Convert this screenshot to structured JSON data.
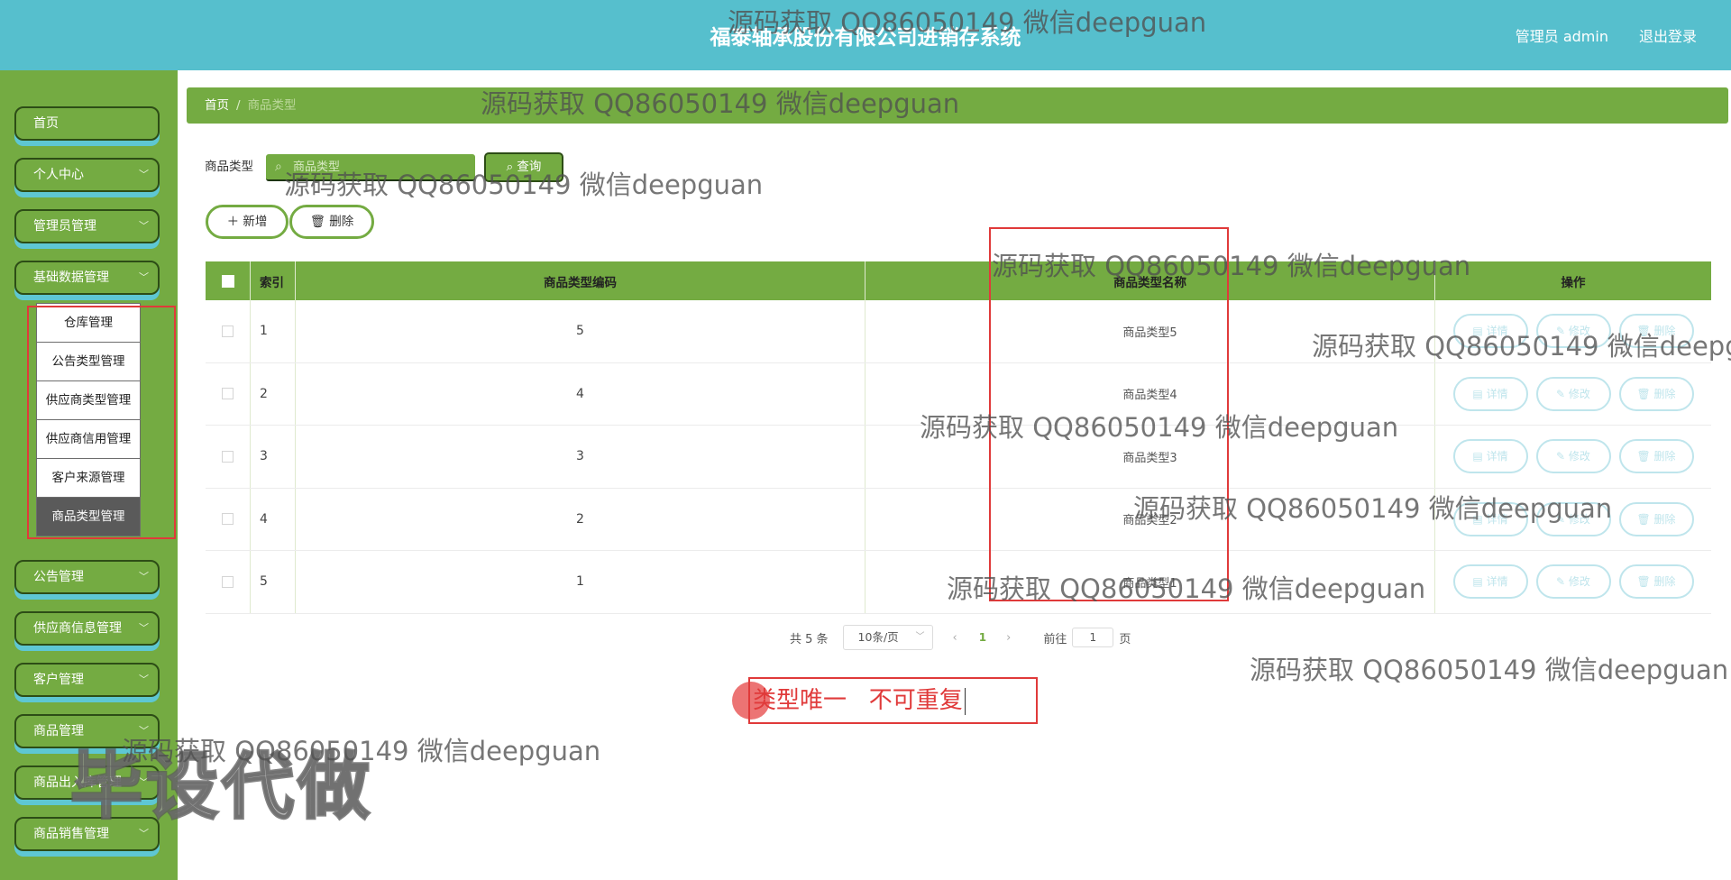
{
  "header": {
    "title": "福泰轴承股份有限公司进销存系统",
    "user_label": "管理员 admin",
    "logout_label": "退出登录"
  },
  "sidebar": {
    "items": [
      {
        "label": "首页",
        "has_chevron": false
      },
      {
        "label": "个人中心",
        "has_chevron": true
      },
      {
        "label": "管理员管理",
        "has_chevron": true
      },
      {
        "label": "基础数据管理",
        "has_chevron": true
      },
      {
        "label": "公告管理",
        "has_chevron": true
      },
      {
        "label": "供应商信息管理",
        "has_chevron": true
      },
      {
        "label": "客户管理",
        "has_chevron": true
      },
      {
        "label": "商品管理",
        "has_chevron": true
      },
      {
        "label": "商品出入库管理",
        "has_chevron": true
      },
      {
        "label": "商品销售管理",
        "has_chevron": true
      }
    ],
    "submenu": [
      {
        "label": "仓库管理"
      },
      {
        "label": "公告类型管理"
      },
      {
        "label": "供应商类型管理"
      },
      {
        "label": "供应商信用管理"
      },
      {
        "label": "客户来源管理"
      },
      {
        "label": "商品类型管理",
        "active": true
      }
    ]
  },
  "breadcrumb": {
    "home": "首页",
    "separator": "/",
    "current": "商品类型"
  },
  "search": {
    "label": "商品类型",
    "placeholder": "商品类型",
    "query_label": "查询"
  },
  "actions": {
    "add_label": "新增",
    "delete_label": "删除"
  },
  "table": {
    "columns": [
      "索引",
      "商品类型编码",
      "商品类型名称",
      "操作"
    ],
    "rows": [
      {
        "index": "1",
        "code": "5",
        "name": "商品类型5"
      },
      {
        "index": "2",
        "code": "4",
        "name": "商品类型4"
      },
      {
        "index": "3",
        "code": "3",
        "name": "商品类型3"
      },
      {
        "index": "4",
        "code": "2",
        "name": "商品类型2"
      },
      {
        "index": "5",
        "code": "1",
        "name": "商品类型1"
      }
    ],
    "row_actions": {
      "detail_label": "详情",
      "edit_label": "修改",
      "delete_label": "删除"
    }
  },
  "pagination": {
    "total": "共 5 条",
    "page_size": "10条/页",
    "current_page": "1",
    "goto_label": "前往",
    "goto_value": "1",
    "page_suffix": "页"
  },
  "annotation": {
    "text": "类型唯一   不可重复"
  },
  "watermark": {
    "text": "源码获取 QQ86050149 微信deepguan",
    "big_text": "毕设代做"
  },
  "colors": {
    "header": "#56bfcd",
    "sidebar": "#74ab42",
    "accent": "#74ab42",
    "highlight": "#e03a3a",
    "op_button": "#bfe5ec"
  },
  "icons": {
    "chevron": "chevron-down-icon",
    "search": "search-icon",
    "plus": "plus-icon",
    "trash": "trash-icon",
    "detail": "document-icon",
    "edit": "pencil-icon"
  }
}
